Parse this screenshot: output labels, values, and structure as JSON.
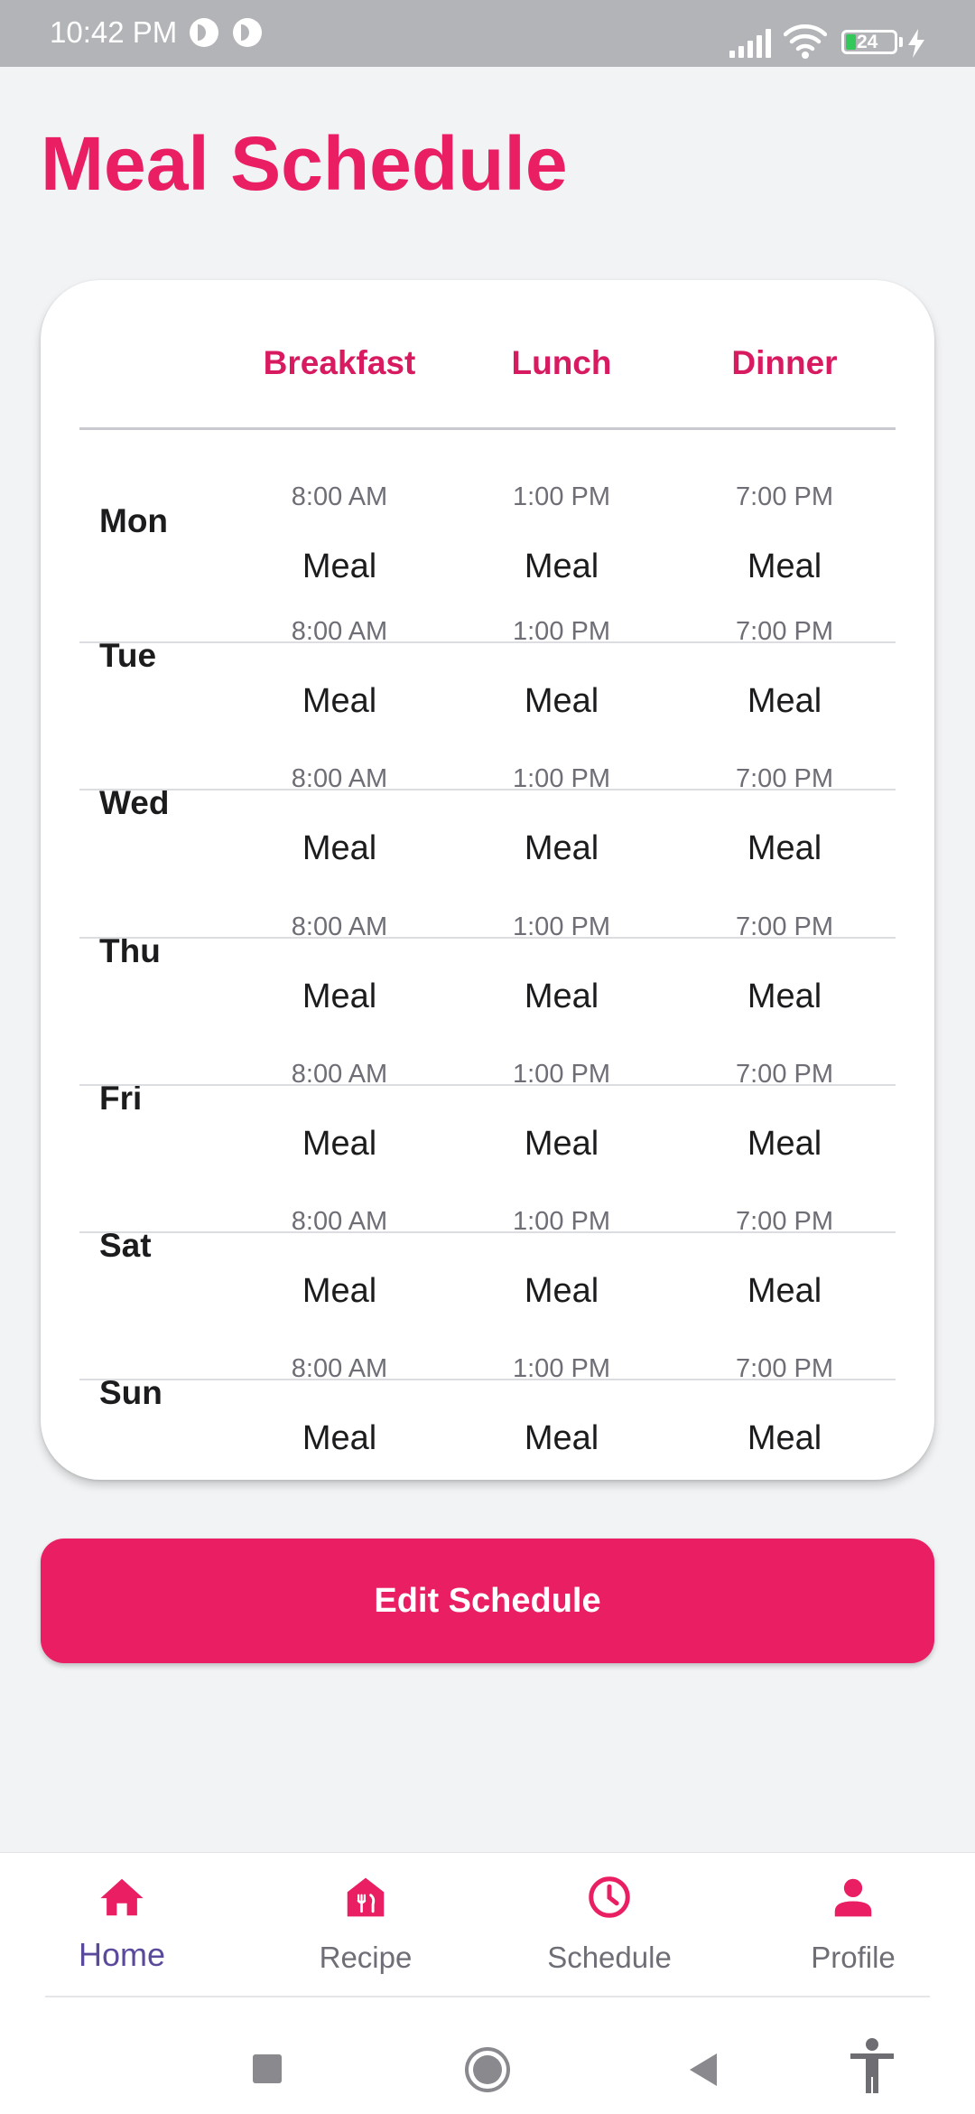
{
  "status_bar": {
    "time": "10:42 PM",
    "battery": "24"
  },
  "page": {
    "title": "Meal Schedule"
  },
  "schedule": {
    "columns": [
      "Breakfast",
      "Lunch",
      "Dinner"
    ],
    "rows": [
      {
        "day": "Mon",
        "times": [
          "8:00 AM",
          "1:00 PM",
          "7:00 PM"
        ],
        "meals": [
          "Meal",
          "Meal",
          "Meal"
        ]
      },
      {
        "day": "Tue",
        "times": [
          "8:00 AM",
          "1:00 PM",
          "7:00 PM"
        ],
        "meals": [
          "Meal",
          "Meal",
          "Meal"
        ]
      },
      {
        "day": "Wed",
        "times": [
          "8:00 AM",
          "1:00 PM",
          "7:00 PM"
        ],
        "meals": [
          "Meal",
          "Meal",
          "Meal"
        ]
      },
      {
        "day": "Thu",
        "times": [
          "8:00 AM",
          "1:00 PM",
          "7:00 PM"
        ],
        "meals": [
          "Meal",
          "Meal",
          "Meal"
        ]
      },
      {
        "day": "Fri",
        "times": [
          "8:00 AM",
          "1:00 PM",
          "7:00 PM"
        ],
        "meals": [
          "Meal",
          "Meal",
          "Meal"
        ]
      },
      {
        "day": "Sat",
        "times": [
          "8:00 AM",
          "1:00 PM",
          "7:00 PM"
        ],
        "meals": [
          "Meal",
          "Meal",
          "Meal"
        ]
      },
      {
        "day": "Sun",
        "times": [
          "8:00 AM",
          "1:00 PM",
          "7:00 PM"
        ],
        "meals": [
          "Meal",
          "Meal",
          "Meal"
        ]
      }
    ]
  },
  "actions": {
    "edit_label": "Edit Schedule"
  },
  "nav": {
    "items": [
      {
        "label": "Home",
        "icon": "home-icon",
        "active": true
      },
      {
        "label": "Recipe",
        "icon": "recipe-icon",
        "active": false
      },
      {
        "label": "Schedule",
        "icon": "clock-icon",
        "active": false
      },
      {
        "label": "Profile",
        "icon": "person-icon",
        "active": false
      }
    ]
  },
  "colors": {
    "accent": "#e91e63",
    "header_text": "#d81b60",
    "active_nav_label": "#5b4a9c",
    "background": "#f2f3f5",
    "status_bar": "#b3b4b7"
  }
}
